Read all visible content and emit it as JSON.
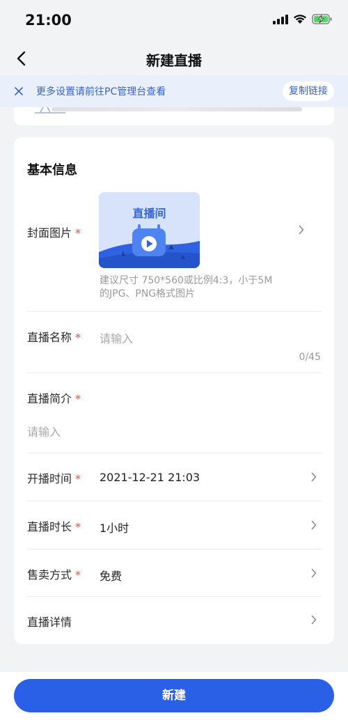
{
  "status_bar": {
    "time": "21:00",
    "battery": "charging"
  },
  "nav": {
    "title": "新建直播",
    "back_icon": "chevron-left-icon"
  },
  "notice": {
    "text": "更多设置请前往PC管理台查看",
    "link_label": "复制链接",
    "close_icon": "close-icon"
  },
  "form": {
    "section_title": "基本信息",
    "cover": {
      "label": "封面图片",
      "required_mark": "*",
      "image_title": "直播间",
      "hint_line1": "建议尺寸 750*560或比例4:3，小于5M",
      "hint_line2": "的JPG、PNG格式图片"
    },
    "name": {
      "label": "直播名称",
      "required_mark": "*",
      "placeholder": "请输入",
      "counter": "0/45"
    },
    "intro": {
      "label": "直播简介",
      "required_mark": "*",
      "placeholder": "请输入"
    },
    "start_time": {
      "label": "开播时间",
      "required_mark": "*",
      "value": "2021-12-21 21:03"
    },
    "duration": {
      "label": "直播时长",
      "required_mark": "*",
      "value": "1小时"
    },
    "sale": {
      "label": "售卖方式",
      "required_mark": "*",
      "value": "免费"
    },
    "details": {
      "label": "直播详情"
    }
  },
  "submit": {
    "label": "新建"
  },
  "colors": {
    "accent": "#2a60e6",
    "notice_bg": "#e9f0fc",
    "required": "#e5533c"
  }
}
